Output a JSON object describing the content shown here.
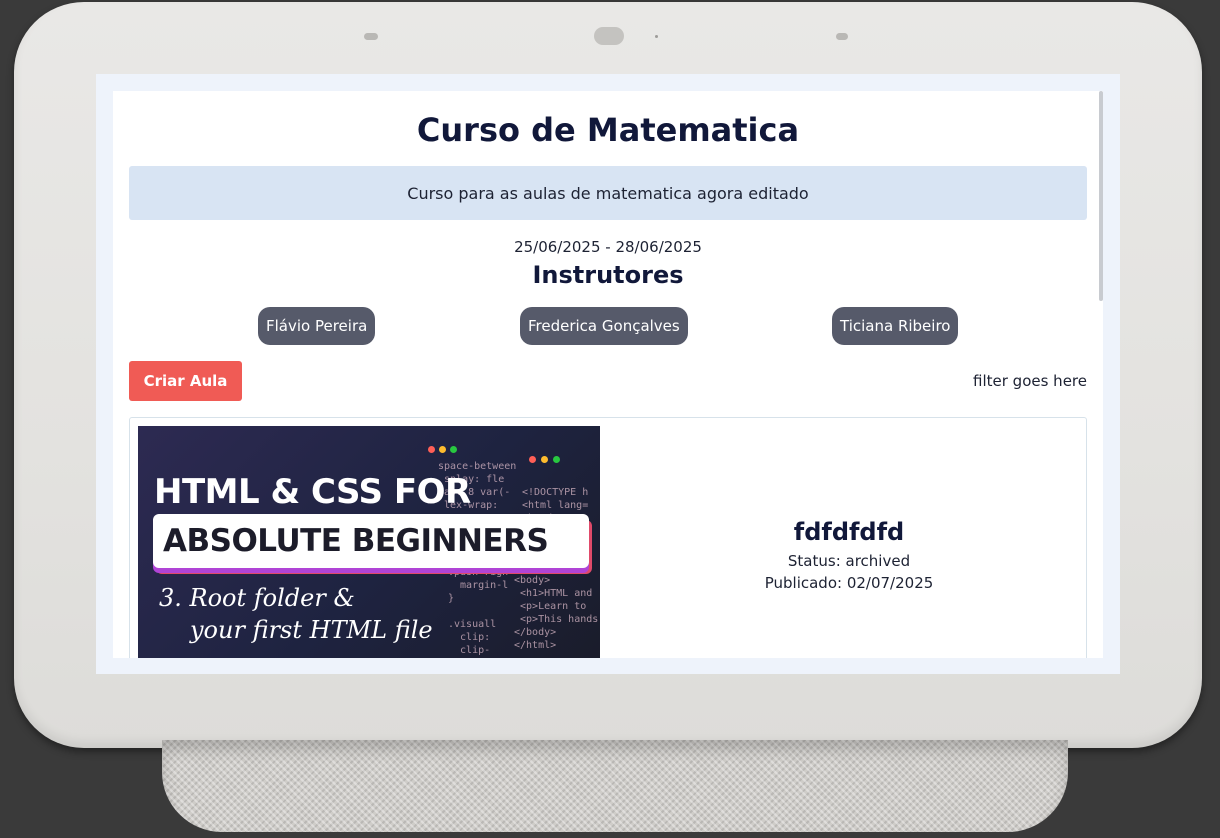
{
  "course": {
    "title": "Curso de Matematica",
    "description": "Curso para as aulas de matematica agora editado",
    "dates": "25/06/2025 - 28/06/2025"
  },
  "instructors": {
    "heading": "Instrutores",
    "names": [
      "Flávio Pereira",
      "Frederica Gonçalves",
      "Ticiana Ribeiro"
    ]
  },
  "toolbar": {
    "create_label": "Criar Aula",
    "filter_text": "filter goes here"
  },
  "lessons": [
    {
      "title": "fdfdfdfd",
      "status": "Status: archived",
      "published": "Publicado: 02/07/2025",
      "thumbnail": {
        "line1": "HTML & CSS FOR",
        "line2": "ABSOLUTE BEGINNERS",
        "line3": "3. Root folder &",
        "line4": "your first HTML file"
      }
    }
  ],
  "colors": {
    "accent_button": "#f05b55",
    "chip": "#565a6a",
    "description_bg": "#d8e4f3",
    "title_text": "#11183a"
  }
}
